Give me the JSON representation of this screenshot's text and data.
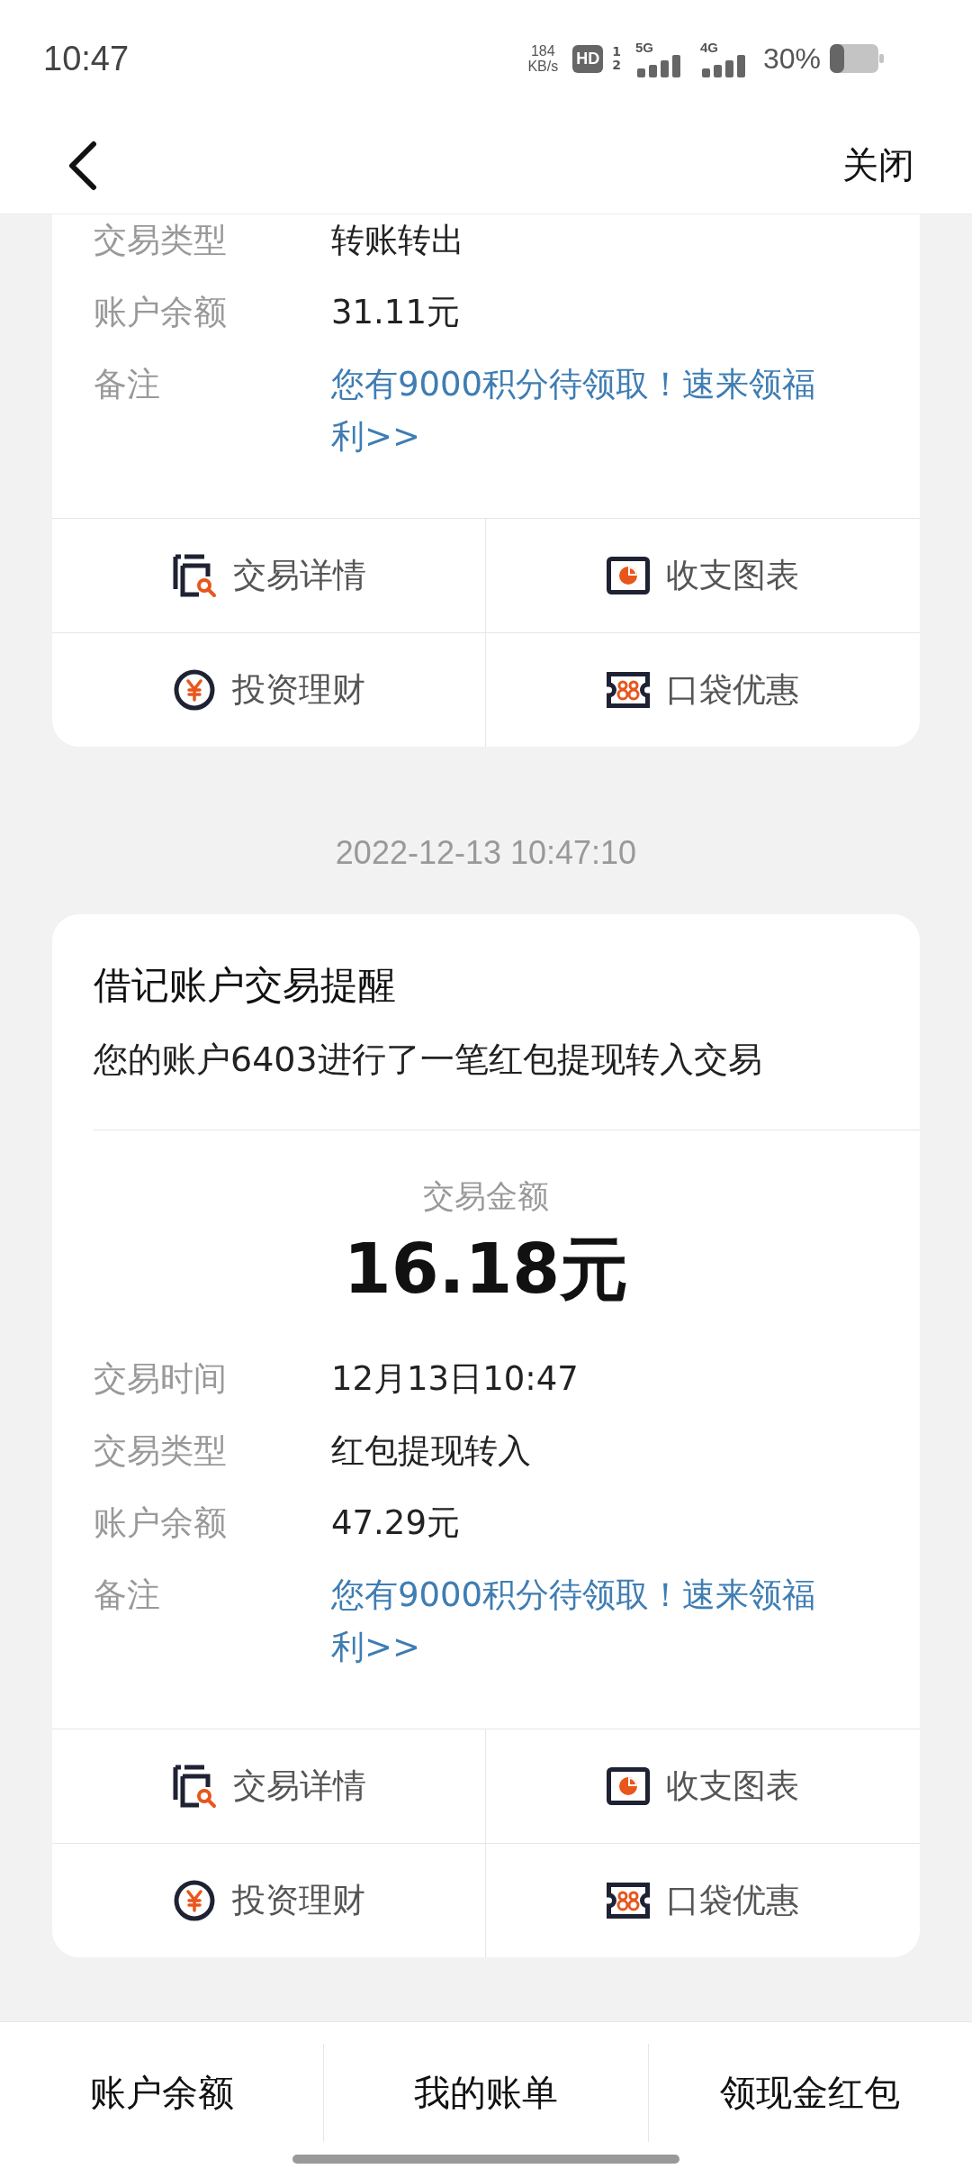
{
  "status_bar": {
    "time": "10:47",
    "net_speed": "184",
    "net_unit": "KB/s",
    "hd": "HD",
    "sim_slots": [
      "1",
      "2"
    ],
    "networks": [
      "5G",
      "4G"
    ],
    "battery": "30%"
  },
  "nav": {
    "close_label": "关闭"
  },
  "feed": [
    {
      "kind": "card",
      "fields": [
        {
          "label": "交易类型",
          "value": "转账转出",
          "kind": "text"
        },
        {
          "label": "账户余额",
          "value": "31.11元",
          "kind": "text"
        },
        {
          "label": "备注",
          "value": "您有9000积分待领取！速来领福利>>",
          "kind": "link"
        }
      ],
      "actions": [
        {
          "label": "交易详情",
          "kind": "details"
        },
        {
          "label": "收支图表",
          "kind": "chart"
        },
        {
          "label": "投资理财",
          "kind": "invest"
        },
        {
          "label": "口袋优惠",
          "kind": "coupon"
        }
      ]
    },
    {
      "kind": "timestamp",
      "text": "2022-12-13 10:47:10"
    },
    {
      "kind": "card",
      "title": "借记账户交易提醒",
      "message": "您的账户6403进行了一笔红包提现转入交易",
      "amount_label": "交易金额",
      "amount": "16.18元",
      "fields": [
        {
          "label": "交易时间",
          "value": "12月13日10:47",
          "kind": "text"
        },
        {
          "label": "交易类型",
          "value": "红包提现转入",
          "kind": "text"
        },
        {
          "label": "账户余额",
          "value": "47.29元",
          "kind": "text"
        },
        {
          "label": "备注",
          "value": "您有9000积分待领取！速来领福利>>",
          "kind": "link"
        }
      ],
      "actions": [
        {
          "label": "交易详情",
          "kind": "details"
        },
        {
          "label": "收支图表",
          "kind": "chart"
        },
        {
          "label": "投资理财",
          "kind": "invest"
        },
        {
          "label": "口袋优惠",
          "kind": "coupon"
        }
      ]
    }
  ],
  "bottom_tabs": [
    "账户余额",
    "我的账单",
    "领现金红包"
  ]
}
